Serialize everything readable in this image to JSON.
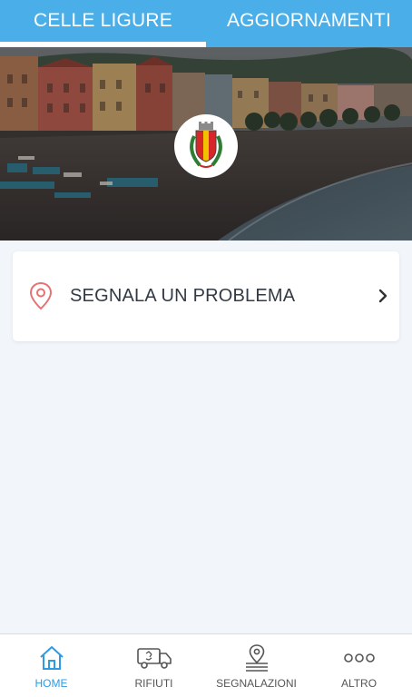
{
  "top_tabs": [
    {
      "label": "CELLE LIGURE",
      "active": true
    },
    {
      "label": "AGGIORNAMENTI",
      "active": false
    }
  ],
  "hero": {
    "image": "beach-town-photo",
    "crest_icon": "municipal-crest-icon"
  },
  "card": {
    "label": "SEGNALA UN PROBLEMA",
    "icon": "location-pin-icon",
    "chevron": "chevron-right-icon"
  },
  "bottom_nav": [
    {
      "label": "HOME",
      "icon": "home-icon",
      "active": true
    },
    {
      "label": "RIFIUTI",
      "icon": "garbage-truck-icon",
      "active": false
    },
    {
      "label": "SEGNALAZIONI",
      "icon": "report-pin-icon",
      "active": false
    },
    {
      "label": "ALTRO",
      "icon": "more-dots-icon",
      "active": false
    }
  ],
  "colors": {
    "accent": "#4aaee8",
    "active_nav": "#2f9be0",
    "pin": "#e57373",
    "background": "#f2f6fa"
  }
}
